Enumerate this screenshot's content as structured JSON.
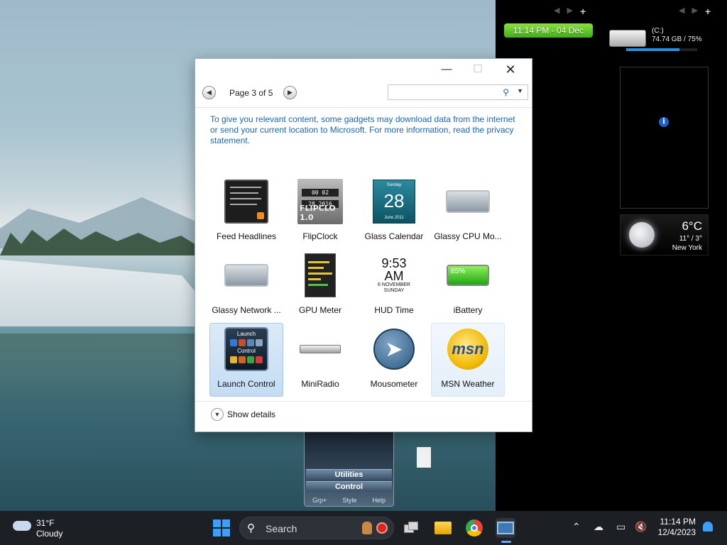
{
  "desktop": {
    "clock_gadget": "11:14 PM - 04 Dec",
    "drive": {
      "label": "(C:)",
      "usage": "74.74 GB / 75%",
      "percent_used": 75
    },
    "weather_gadget": {
      "temp": "6°C",
      "range": "11° / 3°",
      "city": "New York"
    },
    "launch_gadget": {
      "line1": "Utilities",
      "line2": "Control",
      "footer": [
        "Grp+",
        "Style",
        "Help"
      ]
    }
  },
  "dialog": {
    "page_text": "Page 3 of 5",
    "search_placeholder": "",
    "notice": "To give you relevant content, some gadgets may download data from the internet or send your current location to Microsoft. For more information, read the privacy statement.",
    "gadgets": [
      {
        "label": "Feed Headlines",
        "icon": "feed-headlines-icon"
      },
      {
        "label": "FlipClock",
        "icon": "flipclock-icon",
        "thumb_text": "FLIPCLO 1.0"
      },
      {
        "label": "Glass Calendar",
        "icon": "glass-calendar-icon",
        "thumb_day": "28",
        "thumb_top": "Sunday",
        "thumb_month": "June 2011"
      },
      {
        "label": "Glassy CPU Mo...",
        "icon": "glassy-cpu-icon"
      },
      {
        "label": "Glassy Network ...",
        "icon": "glassy-network-icon"
      },
      {
        "label": "GPU Meter",
        "icon": "gpu-meter-icon"
      },
      {
        "label": "HUD Time",
        "icon": "hud-time-icon",
        "thumb_time": "9:53 AM",
        "thumb_date": "6 NOVEMBER",
        "thumb_day": "SUNDAY"
      },
      {
        "label": "iBattery",
        "icon": "ibattery-icon",
        "thumb_text": "85%"
      },
      {
        "label": "Launch Control",
        "icon": "launch-control-icon",
        "thumb_top": "Launch",
        "thumb_mid": "Control",
        "state": "selected"
      },
      {
        "label": "MiniRadio",
        "icon": "miniradio-icon"
      },
      {
        "label": "Mousometer",
        "icon": "mousometer-icon"
      },
      {
        "label": "MSN Weather",
        "icon": "msn-weather-icon",
        "thumb_text": "msn",
        "state": "hover"
      }
    ],
    "show_details": "Show details"
  },
  "taskbar": {
    "weather_temp": "31°F",
    "weather_cond": "Cloudy",
    "search_label": "Search",
    "time": "11:14 PM",
    "date": "12/4/2023"
  },
  "colors": {
    "accent": "#3aa0ff",
    "link": "#1866b5",
    "clock_green": "#5ec825"
  }
}
